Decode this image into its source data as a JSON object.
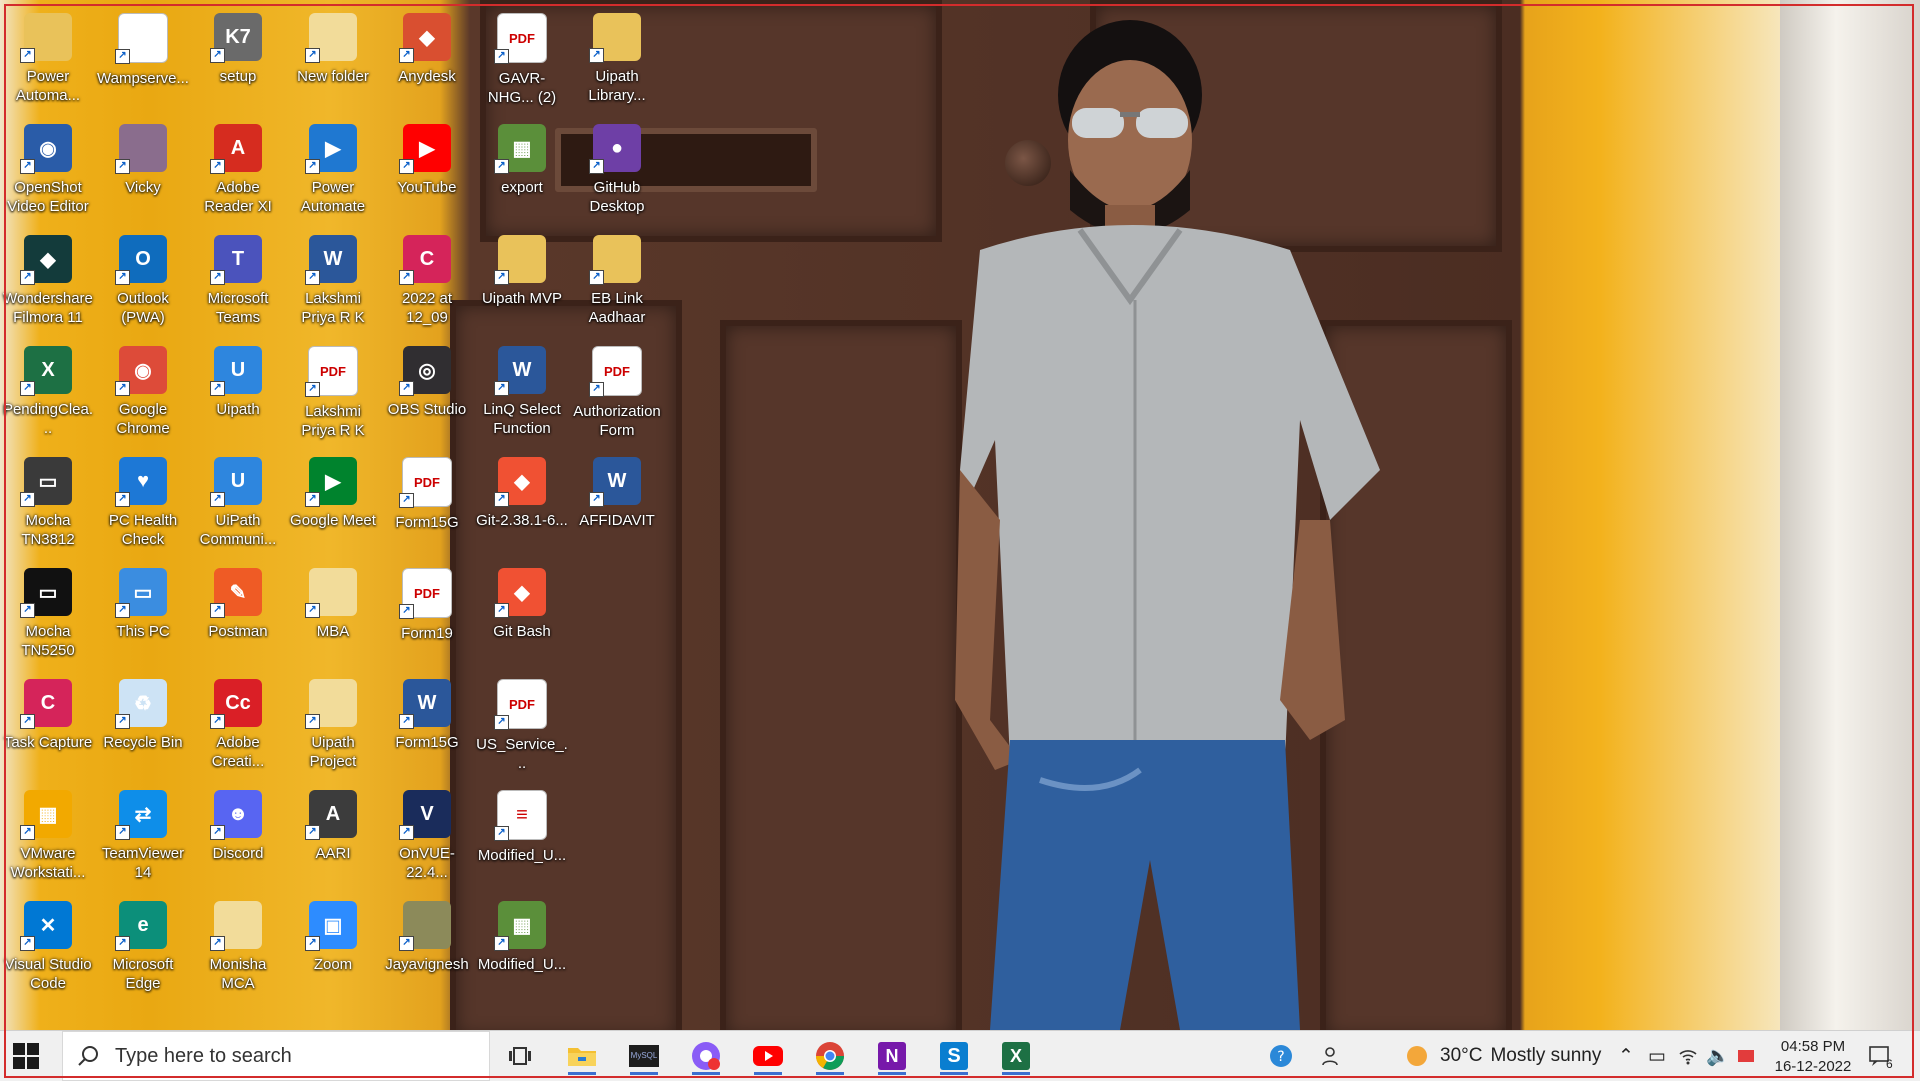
{
  "desktop": {
    "icons": [
      {
        "label": "Power Automa...",
        "icon": "folder-icon",
        "color": "#e9c25a"
      },
      {
        "label": "Wampserve...",
        "icon": "file-icon",
        "color": "#ffffff"
      },
      {
        "label": "setup",
        "icon": "k7-icon",
        "color": "#6a6a6a"
      },
      {
        "label": "New folder",
        "icon": "folder-icon",
        "color": "#f2dc9a"
      },
      {
        "label": "Anydesk",
        "icon": "anydesk-icon",
        "color": "#d94f30"
      },
      {
        "label": "GAVR-NHG... (2)",
        "icon": "pdf-icon",
        "color": "#ffffff"
      },
      {
        "label": "Uipath Library...",
        "icon": "folder-icon",
        "color": "#e9c25a"
      },
      {
        "label": "OpenShot Video Editor",
        "icon": "openshot-icon",
        "color": "#2a5ca8"
      },
      {
        "label": "Vicky",
        "icon": "photo-icon",
        "color": "#8a6d8d"
      },
      {
        "label": "Adobe Reader XI",
        "icon": "adobe-reader-icon",
        "color": "#d62c1f"
      },
      {
        "label": "Power Automate",
        "icon": "power-automate-icon",
        "color": "#1f78d1"
      },
      {
        "label": "YouTube",
        "icon": "youtube-icon",
        "color": "#ff0000"
      },
      {
        "label": "export",
        "icon": "spreadsheet-icon",
        "color": "#5b8f3a"
      },
      {
        "label": "GitHub Desktop",
        "icon": "github-icon",
        "color": "#6e3fa6"
      },
      {
        "label": "Wondershare Filmora 11",
        "icon": "filmora-icon",
        "color": "#133b3b"
      },
      {
        "label": "Outlook (PWA)",
        "icon": "outlook-icon",
        "color": "#0f6cbd"
      },
      {
        "label": "Microsoft Teams",
        "icon": "teams-icon",
        "color": "#4b53bc"
      },
      {
        "label": "Lakshmi Priya R K",
        "icon": "word-icon",
        "color": "#2b579a"
      },
      {
        "label": "2022 at 12_09",
        "icon": "task-capture-icon",
        "color": "#d5245a"
      },
      {
        "label": "Uipath MVP",
        "icon": "folder-icon",
        "color": "#e9c25a"
      },
      {
        "label": "EB Link Aadhaar",
        "icon": "folder-icon",
        "color": "#e9c25a"
      },
      {
        "label": "PendingClea...",
        "icon": "excel-icon",
        "color": "#1d7044"
      },
      {
        "label": "Google Chrome",
        "icon": "chrome-icon",
        "color": "#dd4b39"
      },
      {
        "label": "Uipath",
        "icon": "uipath-icon",
        "color": "#2e86de"
      },
      {
        "label": "Lakshmi Priya R K",
        "icon": "pdf-icon",
        "color": "#ffffff"
      },
      {
        "label": "OBS Studio",
        "icon": "obs-icon",
        "color": "#302e31"
      },
      {
        "label": "LinQ Select Function",
        "icon": "word-icon",
        "color": "#2b579a"
      },
      {
        "label": "Authorization Form",
        "icon": "pdf-icon",
        "color": "#ffffff"
      },
      {
        "label": "Mocha TN3812",
        "icon": "terminal-icon",
        "color": "#3a3a3a"
      },
      {
        "label": "PC Health Check",
        "icon": "health-check-icon",
        "color": "#1d78d6"
      },
      {
        "label": "UiPath Communi...",
        "icon": "uipath-forum-icon",
        "color": "#2e86de"
      },
      {
        "label": "Google Meet",
        "icon": "meet-icon",
        "color": "#00832d"
      },
      {
        "label": "Form15G",
        "icon": "pdf-icon",
        "color": "#ffffff"
      },
      {
        "label": "Git-2.38.1-6...",
        "icon": "git-icon",
        "color": "#f05133"
      },
      {
        "label": "AFFIDAVIT",
        "icon": "word-icon",
        "color": "#2b579a"
      },
      {
        "label": "Mocha TN5250",
        "icon": "terminal-icon",
        "color": "#111111"
      },
      {
        "label": "This PC",
        "icon": "computer-icon",
        "color": "#3b8de0"
      },
      {
        "label": "Postman",
        "icon": "postman-icon",
        "color": "#ef5b25"
      },
      {
        "label": "MBA",
        "icon": "folder-icon",
        "color": "#f2dc9a"
      },
      {
        "label": "Form19",
        "icon": "pdf-icon",
        "color": "#ffffff"
      },
      {
        "label": "Git Bash",
        "icon": "git-icon",
        "color": "#f05133"
      },
      {
        "label": "Task Capture",
        "icon": "task-capture-icon",
        "color": "#d5245a"
      },
      {
        "label": "Recycle Bin",
        "icon": "recycle-bin-icon",
        "color": "#cde3f5"
      },
      {
        "label": "Adobe Creati...",
        "icon": "creative-cloud-icon",
        "color": "#da1f26"
      },
      {
        "label": "Uipath Project",
        "icon": "folder-icon",
        "color": "#f2dc9a"
      },
      {
        "label": "Form15G",
        "icon": "word-icon",
        "color": "#2b579a"
      },
      {
        "label": "US_Service_...",
        "icon": "pdf-icon",
        "color": "#ffffff"
      },
      {
        "label": "VMware Workstati...",
        "icon": "vmware-icon",
        "color": "#f2a900"
      },
      {
        "label": "TeamViewer 14",
        "icon": "teamviewer-icon",
        "color": "#0e8ee9"
      },
      {
        "label": "Discord",
        "icon": "discord-icon",
        "color": "#5865f2"
      },
      {
        "label": "AARI",
        "icon": "aari-icon",
        "color": "#3c3c3c"
      },
      {
        "label": "OnVUE-22.4...",
        "icon": "onvue-icon",
        "color": "#1a2c5b"
      },
      {
        "label": "Modified_U...",
        "icon": "text-file-icon",
        "color": "#ffffff"
      },
      {
        "label": "Visual Studio Code",
        "icon": "vscode-icon",
        "color": "#0078d4"
      },
      {
        "label": "Microsoft Edge",
        "icon": "edge-icon",
        "color": "#0c8f7a"
      },
      {
        "label": "Monisha MCA",
        "icon": "folder-icon",
        "color": "#f2dc9a"
      },
      {
        "label": "Zoom",
        "icon": "zoom-icon",
        "color": "#2d8cff"
      },
      {
        "label": "Jayavignesh",
        "icon": "photo-icon",
        "color": "#8c8a5a"
      },
      {
        "label": "Modified_U...",
        "icon": "spreadsheet-icon",
        "color": "#5b8f3a"
      }
    ]
  },
  "taskbar": {
    "search_placeholder": "Type here to search",
    "apps": [
      {
        "name": "task-view",
        "icon": "task-view-icon"
      },
      {
        "name": "file-explorer",
        "icon": "folder-icon"
      },
      {
        "name": "mysql",
        "icon": "mysql-icon"
      },
      {
        "name": "chrome-profile",
        "icon": "chrome-profile-icon"
      },
      {
        "name": "youtube",
        "icon": "youtube-icon"
      },
      {
        "name": "chrome",
        "icon": "chrome-icon"
      },
      {
        "name": "onenote",
        "icon": "onenote-icon"
      },
      {
        "name": "skype-business",
        "icon": "skype-icon"
      },
      {
        "name": "excel",
        "icon": "excel-icon"
      }
    ],
    "weather": {
      "temp": "30°C",
      "condition": "Mostly sunny"
    },
    "clock": {
      "time": "04:58 PM",
      "date": "16-12-2022"
    },
    "notifications_count": "6"
  }
}
